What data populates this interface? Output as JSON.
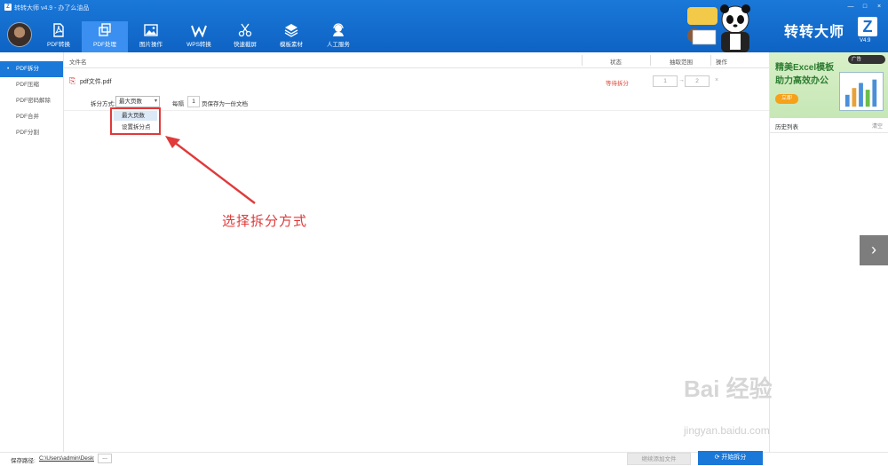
{
  "window": {
    "title": "转转大师 v4.9 - 办了么油品",
    "logo_letter": "Z",
    "controls": [
      "—",
      "□",
      "×"
    ]
  },
  "nav": {
    "items": [
      {
        "label": "PDF转换",
        "icon": "pdf-icon"
      },
      {
        "label": "PDF处理",
        "icon": "copy-icon",
        "active": true
      },
      {
        "label": "图片操作",
        "icon": "image-icon"
      },
      {
        "label": "WPS转换",
        "icon": "wps-icon"
      },
      {
        "label": "快速截屏",
        "icon": "scissors-icon"
      },
      {
        "label": "模板素材",
        "icon": "layers-icon"
      },
      {
        "label": "人工服务",
        "icon": "support-icon"
      }
    ]
  },
  "brand": {
    "name": "转转大师",
    "letter": "Z",
    "version": "V4.9"
  },
  "sidebar": {
    "items": [
      {
        "label": "PDF拆分",
        "active": true
      },
      {
        "label": "PDF压缩"
      },
      {
        "label": "PDF密码解除"
      },
      {
        "label": "PDF合并"
      },
      {
        "label": "PDF分割"
      }
    ]
  },
  "table": {
    "headers": {
      "filename": "文件名",
      "status": "状态",
      "range": "抽取范围",
      "action": "操作"
    },
    "row": {
      "filename": "pdf文件.pdf",
      "status": "等待拆分",
      "range_from": "1",
      "range_to": "2",
      "delete_icon": "close-icon"
    }
  },
  "options": {
    "split_label": "拆分方式:",
    "split_value": "最大页数",
    "every_label": "每隔",
    "pages_value": "1",
    "pages_suffix": "页保存为一份文档"
  },
  "dropdown": {
    "options": [
      "最大页数",
      "设置拆分点"
    ],
    "selected_index": 0
  },
  "annotation": {
    "text": "选择拆分方式",
    "color": "#e03a3a"
  },
  "right_panel": {
    "ad": {
      "line1": "精美Excel模板",
      "line2": "助力高效办公",
      "button": "立即",
      "close": "广告"
    },
    "history_title": "历史列表",
    "history_clear": "清空"
  },
  "footer": {
    "save_label": "保存路径:",
    "save_path": "C:\\Users\\admin\\Desktop",
    "browse_label": "...",
    "add_more_label": "继续添加文件",
    "start_label": "开始拆分"
  },
  "watermark": {
    "main": "Bai 经验",
    "sub": "jingyan.baidu.com"
  },
  "colors": {
    "header": "#1a78d8",
    "accent": "#1a78d8",
    "annotation": "#e03a3a",
    "status": "#e24a3d"
  }
}
